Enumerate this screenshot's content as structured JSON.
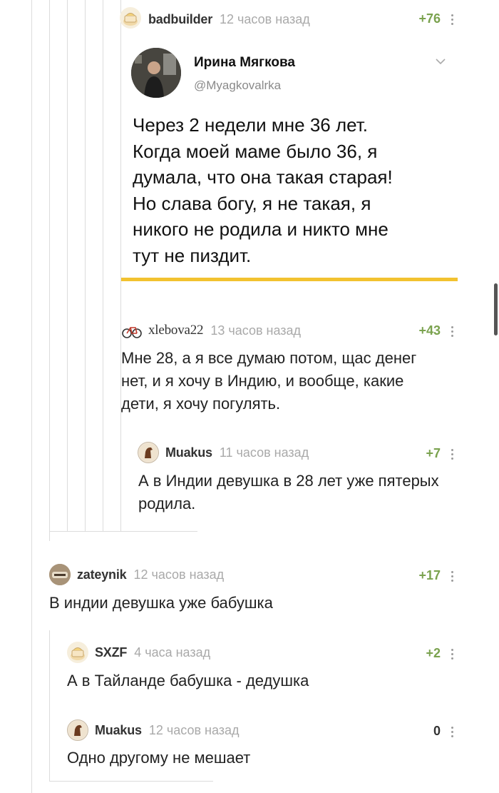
{
  "colors": {
    "rating_positive": "#7aa24e",
    "rating_zero": "#333333",
    "thread_line": "#dcdcdc",
    "tweet_underline": "#f2c230",
    "username": "#333333",
    "timestamp": "#a9a9a9"
  },
  "comments": [
    {
      "username": "badbuilder",
      "time": "12 часов назад",
      "rating": "+76",
      "avatar_icon": "builder-cake-avatar-icon",
      "tweet": {
        "name": "Ирина Мягкова",
        "handle": "@Myagkovalrka",
        "text_lines": [
          "Через 2 недели мне 36 лет.",
          "Когда моей маме было 36, я",
          "думала, что она такая старая!",
          "Но слава богу, я не такая, я",
          "никого не родила и никто мне",
          "тут не пиздит."
        ]
      }
    },
    {
      "username": "xlebova22",
      "time": "13 часов назад",
      "rating": "+43",
      "avatar_icon": "bicycle-avatar-icon",
      "text_lines": [
        "Мне 28, а я все думаю потом, щас денег",
        "нет, и я хочу в Индию, и вообще, какие",
        "дети, я хочу погулять."
      ]
    },
    {
      "username": "Muakus",
      "time": "11 часов назад",
      "rating": "+7",
      "avatar_icon": "horse-avatar-icon",
      "text_lines": [
        "А в Индии девушка в 28 лет уже пятерых",
        "родила."
      ]
    },
    {
      "username": "zateynik",
      "time": "12 часов назад",
      "rating": "+17",
      "avatar_icon": "hat-avatar-icon",
      "text_lines": [
        "В индии девушка уже бабушка"
      ]
    },
    {
      "username": "SXZF",
      "time": "4 часа назад",
      "rating": "+2",
      "avatar_icon": "builder-cake-avatar-icon",
      "text_lines": [
        "А в Тайланде бабушка - дедушка"
      ]
    },
    {
      "username": "Muakus",
      "time": "12 часов назад",
      "rating": "0",
      "avatar_icon": "horse-avatar-icon",
      "text_lines": [
        "Одно другому не мешает"
      ]
    }
  ]
}
